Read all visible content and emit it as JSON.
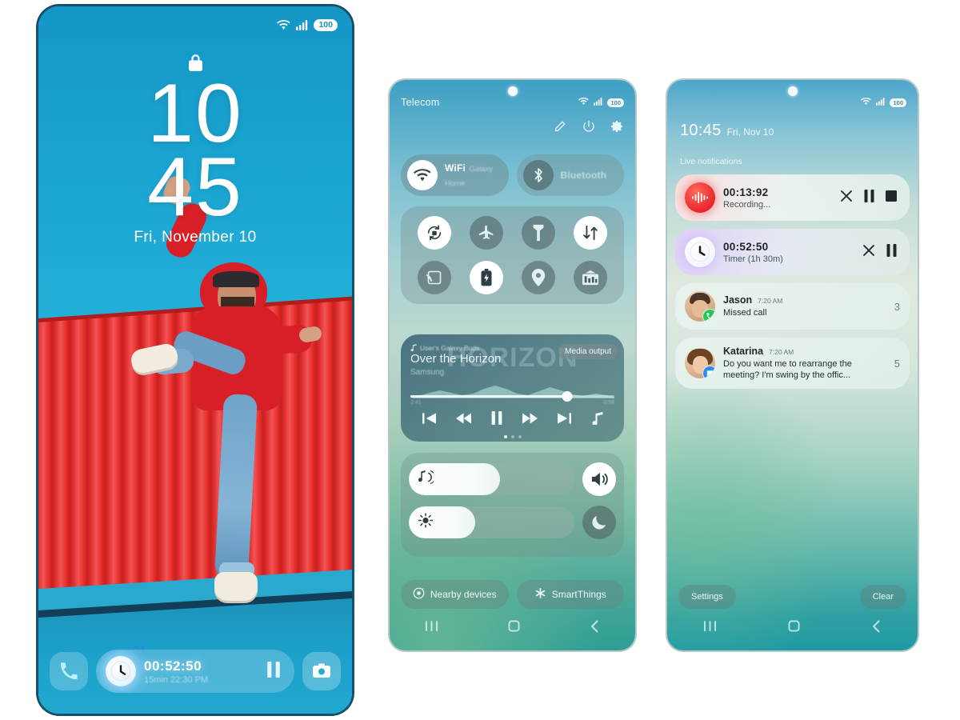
{
  "meta": {
    "background_color": "#ffffff"
  },
  "lock_screen": {
    "status_bar": {
      "wifi_icon": "wifi-icon",
      "signal_icon": "signal-bars-icon",
      "battery_level": "100"
    },
    "lock_icon": "lock-icon",
    "time_hour": "10",
    "time_minute": "45",
    "date": "Fri, November 10",
    "widget_badge": "21",
    "shortcuts": {
      "left_icon": "phone-icon",
      "right_icon": "camera-icon"
    },
    "notification": {
      "icon": "clock-icon",
      "time": "00:52:50",
      "subtitle": "15min 22:30 PM",
      "action_icon": "pause-icon"
    }
  },
  "quick_settings": {
    "status_bar": {
      "carrier": "Telecom",
      "wifi_icon": "wifi-icon",
      "signal_icon": "signal-bars-icon",
      "battery_level": "100"
    },
    "actions": [
      {
        "name": "edit-button",
        "icon": "pencil-icon"
      },
      {
        "name": "power-button",
        "icon": "power-icon"
      },
      {
        "name": "settings-button",
        "icon": "gear-icon"
      }
    ],
    "top_toggles": [
      {
        "label": "WiFi",
        "sublabel": "Galaxy Home",
        "icon": "wifi-icon",
        "state": "on"
      },
      {
        "label": "Bluetooth",
        "sublabel": "",
        "icon": "bluetooth-icon",
        "state": "off"
      }
    ],
    "tiles": [
      {
        "label": "Auto rotate",
        "icon": "auto-rotate-icon",
        "state": "on"
      },
      {
        "label": "Airplane mode",
        "icon": "airplane-icon",
        "state": "off"
      },
      {
        "label": "Flashlight",
        "icon": "flashlight-icon",
        "state": "off"
      },
      {
        "label": "Mobile data",
        "icon": "data-transfer-icon",
        "state": "on"
      },
      {
        "label": "Smart View",
        "icon": "screen-cast-icon",
        "state": "off"
      },
      {
        "label": "Power saving",
        "icon": "battery-saver-icon",
        "state": "on"
      },
      {
        "label": "Location",
        "icon": "location-pin-icon",
        "state": "off"
      },
      {
        "label": "Dolby Atmos",
        "icon": "equalizer-icon",
        "state": "off"
      }
    ],
    "media": {
      "device": "User's Galaxy Buds",
      "device_icon": "music-note-icon",
      "title": "Over the Horizon",
      "artist": "Samsung",
      "album_art_text": "HORIZON",
      "output_tooltip": "Media output",
      "elapsed": "2:41",
      "remaining": "0:58",
      "progress_percent": 77,
      "controls": [
        {
          "name": "previous-track-button",
          "icon": "skip-previous-icon"
        },
        {
          "name": "rewind-button",
          "icon": "rewind-icon"
        },
        {
          "name": "pause-button",
          "icon": "pause-icon"
        },
        {
          "name": "fast-forward-button",
          "icon": "fast-forward-icon"
        },
        {
          "name": "next-track-button",
          "icon": "skip-next-icon"
        },
        {
          "name": "music-button",
          "icon": "music-note-icon"
        }
      ],
      "page_dots": 3,
      "active_dot": 0
    },
    "sliders": [
      {
        "name": "volume-slider",
        "icon": "volume-music-icon",
        "value": 55,
        "side_icon": "speaker-icon",
        "side_state": "on"
      },
      {
        "name": "brightness-slider",
        "icon": "brightness-icon",
        "value": 40,
        "side_icon": "moon-icon",
        "side_state": "off"
      }
    ],
    "footer_buttons": [
      {
        "label": "Nearby devices",
        "icon": "nearby-share-icon"
      },
      {
        "label": "SmartThings",
        "icon": "smartthings-icon"
      }
    ],
    "nav_bar": [
      {
        "name": "recents-button",
        "icon": "recents-icon"
      },
      {
        "name": "home-button",
        "icon": "home-square-icon"
      },
      {
        "name": "back-button",
        "icon": "back-chevron-icon"
      }
    ]
  },
  "notification_panel": {
    "status_bar": {
      "wifi_icon": "wifi-icon",
      "signal_icon": "signal-bars-icon",
      "battery_level": "100"
    },
    "time": "10:45",
    "date": "Fri, Nov 10",
    "section_label": "Live notifications",
    "notifications": [
      {
        "type": "recording",
        "icon": "voice-recorder-icon",
        "time": "00:13:92",
        "subtitle": "Recording...",
        "actions": [
          {
            "name": "close-button",
            "icon": "close-icon"
          },
          {
            "name": "pause-button",
            "icon": "pause-icon"
          },
          {
            "name": "stop-button",
            "icon": "stop-icon"
          }
        ]
      },
      {
        "type": "timer",
        "icon": "clock-icon",
        "time": "00:52:50",
        "subtitle": "Timer (1h 30m)",
        "actions": [
          {
            "name": "close-button",
            "icon": "close-icon"
          },
          {
            "name": "pause-button",
            "icon": "pause-icon"
          }
        ]
      },
      {
        "type": "missed_call",
        "avatar": "avatar-jason",
        "badge_icon": "phone-icon",
        "name": "Jason",
        "timestamp": "7:20 AM",
        "message": "Missed call",
        "count": "3"
      },
      {
        "type": "message",
        "avatar": "avatar-katarina",
        "badge_icon": "message-icon",
        "name": "Katarina",
        "timestamp": "7:20 AM",
        "message": "Do you want me to rearrange the meeting? I'm swing by the offic...",
        "count": "5"
      }
    ],
    "footer": {
      "settings_label": "Settings",
      "clear_label": "Clear"
    },
    "nav_bar": [
      {
        "name": "recents-button",
        "icon": "recents-icon"
      },
      {
        "name": "home-button",
        "icon": "home-square-icon"
      },
      {
        "name": "back-button",
        "icon": "back-chevron-icon"
      }
    ]
  }
}
